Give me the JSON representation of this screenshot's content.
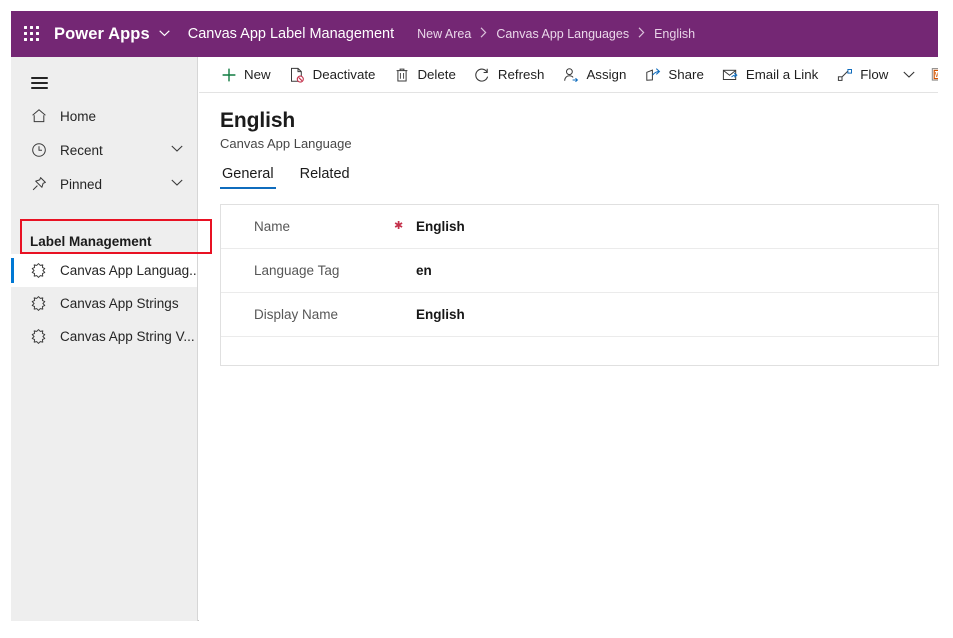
{
  "topbar": {
    "waffle_label": "app-launcher",
    "brand": "Power Apps",
    "app_name": "Canvas App Label Management",
    "breadcrumb": [
      {
        "label": "New Area"
      },
      {
        "label": "Canvas App Languages"
      },
      {
        "label": "English"
      }
    ],
    "separator": "›",
    "background_color": "#742774"
  },
  "sidebar": {
    "nav_items": [
      {
        "label": "Home",
        "icon": "home-icon",
        "chevron": false
      },
      {
        "label": "Recent",
        "icon": "clock-icon",
        "chevron": true
      },
      {
        "label": "Pinned",
        "icon": "pin-icon",
        "chevron": true
      }
    ],
    "group_title": "Label Management",
    "entities": [
      {
        "label": "Canvas App Languag...",
        "icon": "entity-icon",
        "selected": true
      },
      {
        "label": "Canvas App Strings",
        "icon": "entity-icon",
        "selected": false
      },
      {
        "label": "Canvas App String V...",
        "icon": "entity-icon",
        "selected": false
      }
    ],
    "chevron_glyph": "⌄",
    "highlight_color": "#e81123",
    "accent_color": "#0078d4"
  },
  "commandbar": {
    "commands": [
      {
        "label": "New",
        "icon": "plus-icon"
      },
      {
        "label": "Deactivate",
        "icon": "deactivate-icon"
      },
      {
        "label": "Delete",
        "icon": "trash-icon"
      },
      {
        "label": "Refresh",
        "icon": "refresh-icon"
      },
      {
        "label": "Assign",
        "icon": "assign-person-icon"
      },
      {
        "label": "Share",
        "icon": "share-icon"
      },
      {
        "label": "Email a Link",
        "icon": "email-link-icon"
      },
      {
        "label": "Flow",
        "icon": "flow-icon",
        "chevron": true
      },
      {
        "label": "",
        "icon": "word-templates-icon"
      }
    ],
    "chevron_glyph": "⌄"
  },
  "record": {
    "title": "English",
    "subtitle": "Canvas App Language",
    "tabs": [
      {
        "label": "General",
        "active": true
      },
      {
        "label": "Related",
        "active": false
      }
    ],
    "fields": [
      {
        "label": "Name",
        "required": true,
        "value": "English"
      },
      {
        "label": "Language Tag",
        "required": false,
        "value": "en"
      },
      {
        "label": "Display Name",
        "required": false,
        "value": "English"
      }
    ],
    "required_glyph": "✱"
  }
}
